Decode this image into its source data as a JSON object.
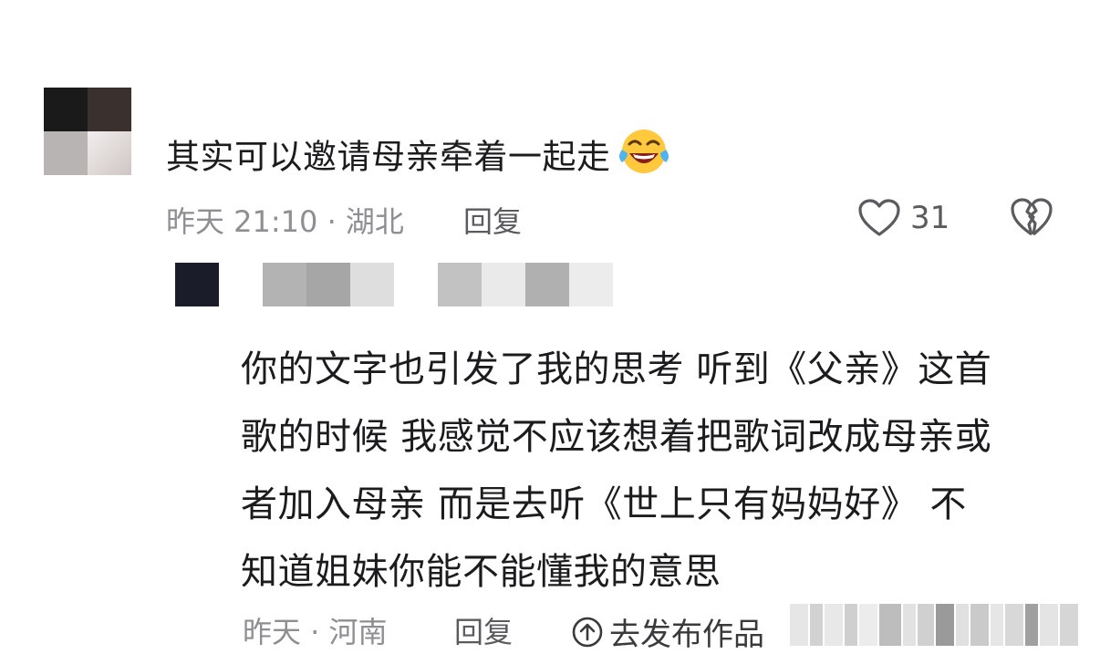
{
  "comment": {
    "text": "其实可以邀请母亲牵着一起走",
    "emoji_icon": "tears-of-joy-emoji",
    "meta": "昨天 21:10 · 湖北",
    "reply_label": "回复",
    "like_count": "31"
  },
  "reply": {
    "lines": [
      "你的文字也引发了我的思考 听到《父亲》这首",
      "歌的时候 我感觉不应该想着把歌词改成母亲或",
      "者加入母亲 而是去听《世上只有妈妈好》 不",
      "知道姐妹你能不能懂我的意思"
    ],
    "meta": "昨天 · 河南",
    "reply_label": "回复",
    "repost_label": "去发布作品"
  }
}
